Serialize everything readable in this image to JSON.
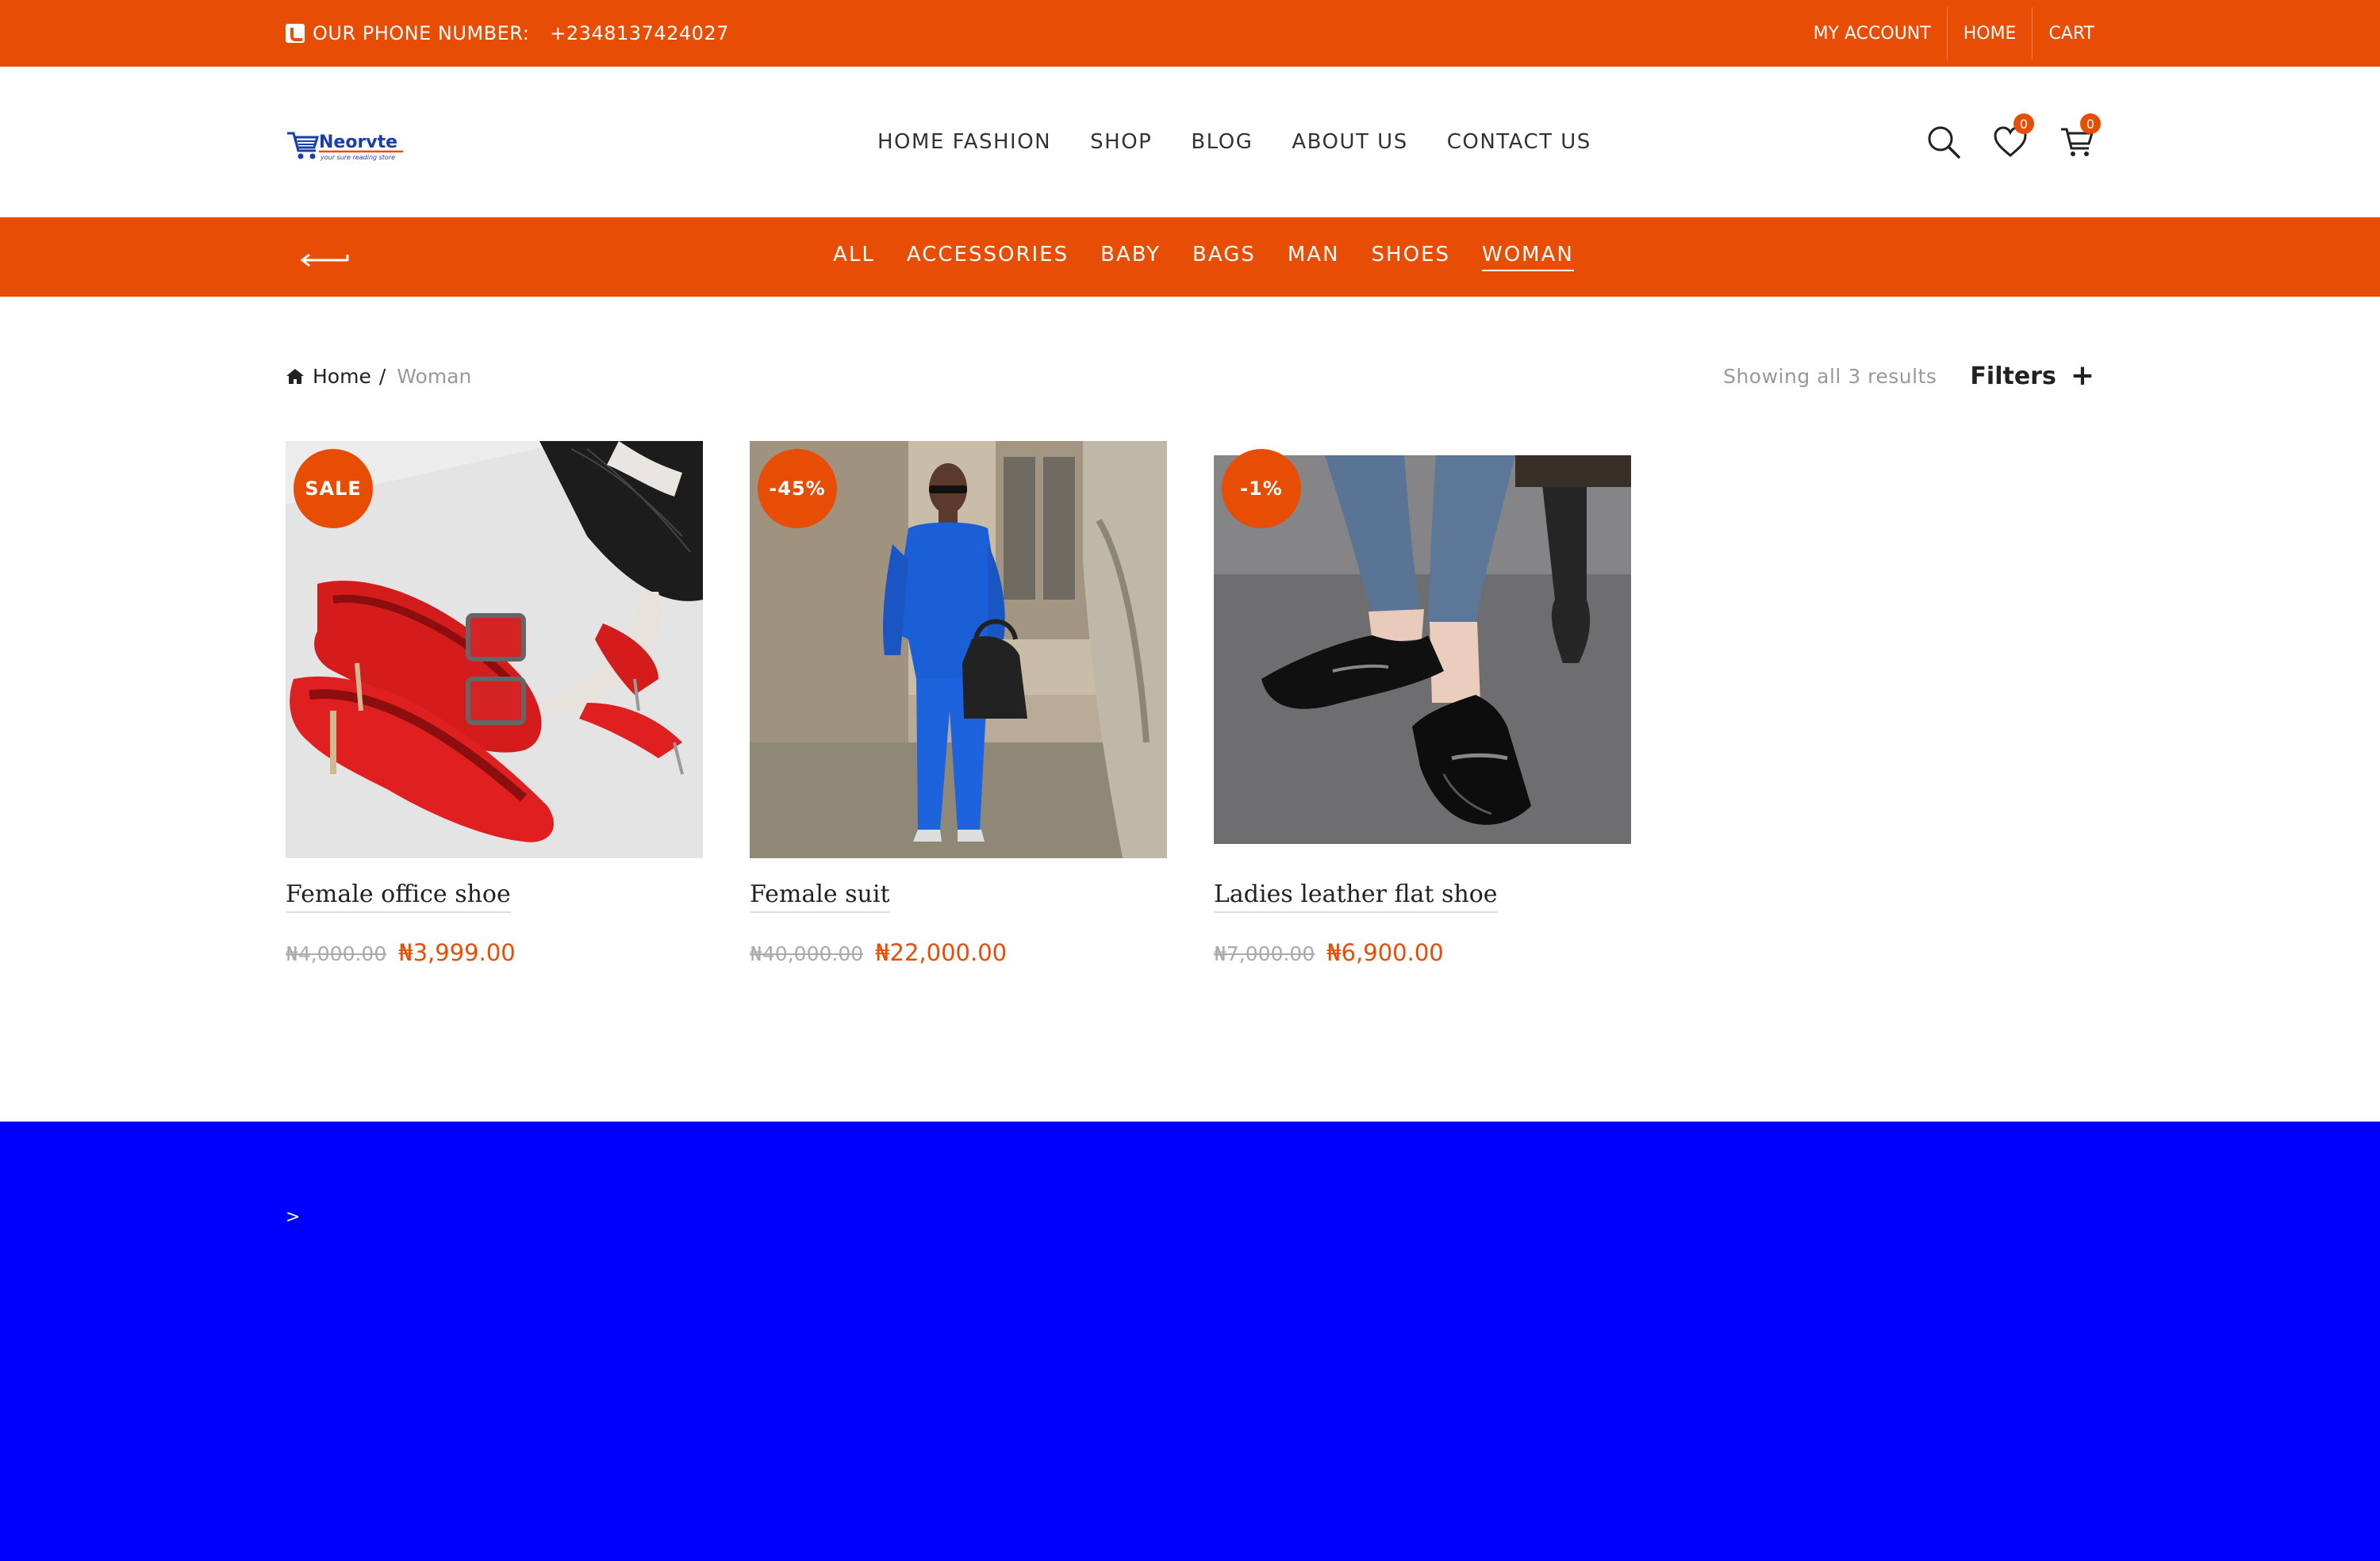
{
  "topbar": {
    "phone_label": "OUR PHONE NUMBER:",
    "phone_number": "+2348137424027",
    "links": [
      "MY ACCOUNT",
      "HOME",
      "CART"
    ]
  },
  "header": {
    "logo_text": "Neorvte",
    "logo_tagline": "your sure reading store",
    "nav": [
      "HOME FASHION",
      "SHOP",
      "BLOG",
      "ABOUT US",
      "CONTACT US"
    ],
    "wishlist_count": "0",
    "cart_count": "0"
  },
  "categories": {
    "items": [
      "ALL",
      "ACCESSORIES",
      "BABY",
      "BAGS",
      "MAN",
      "SHOES",
      "WOMAN"
    ],
    "active": "WOMAN"
  },
  "breadcrumb": {
    "home": "Home",
    "separator": "/",
    "current": "Woman"
  },
  "tools": {
    "results": "Showing all 3 results",
    "filters": "Filters",
    "filters_icon": "+"
  },
  "products": [
    {
      "badge": "SALE",
      "title": "Female office shoe",
      "old_price": "₦4,000.00",
      "price": "₦3,999.00"
    },
    {
      "badge": "-45%",
      "title": "Female suit",
      "old_price": "₦40,000.00",
      "price": "₦22,000.00"
    },
    {
      "badge": "-1%",
      "title": "Ladies leather flat shoe",
      "old_price": "₦7,000.00",
      "price": "₦6,900.00"
    }
  ],
  "footer": {
    "text": ">"
  },
  "colors": {
    "accent": "#e84d05",
    "footer_bg": "#0000fe"
  }
}
